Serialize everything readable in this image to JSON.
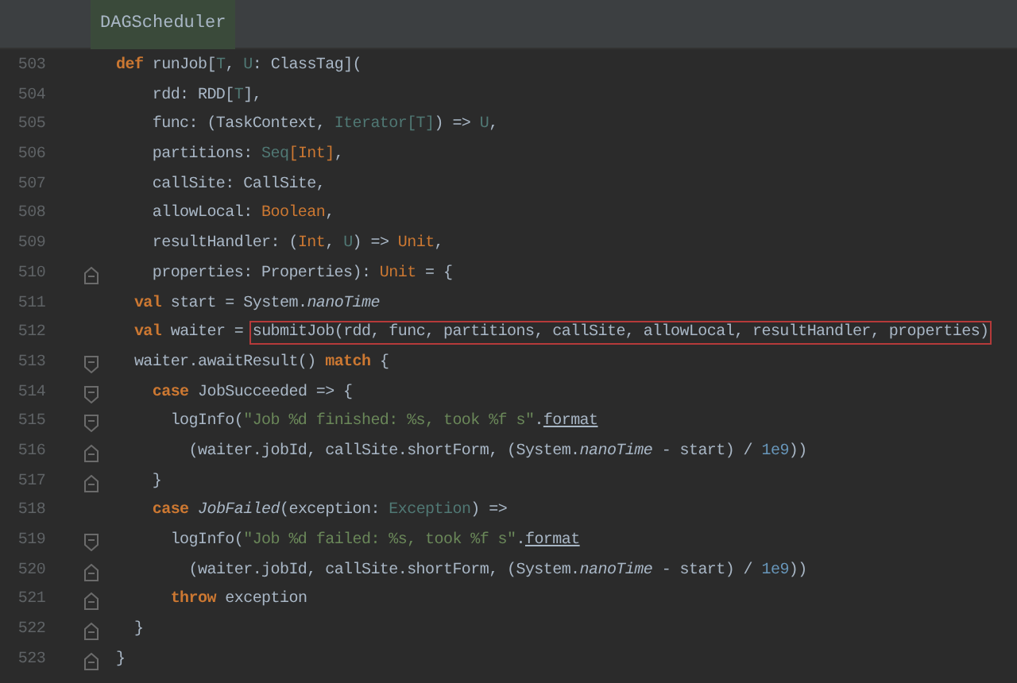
{
  "tab": {
    "label": "DAGScheduler",
    "selected": true
  },
  "lines": [
    {
      "number": "503",
      "fold_start": false,
      "fold_end": false,
      "tokens": [
        {
          "kind": "keyword",
          "text": "def"
        },
        {
          "kind": "plain",
          "text": " runJob["
        },
        {
          "kind": "type",
          "text": "T"
        },
        {
          "kind": "plain",
          "text": ", "
        },
        {
          "kind": "type",
          "text": "U"
        },
        {
          "kind": "plain",
          "text": ": ClassTag]("
        }
      ]
    },
    {
      "number": "504",
      "fold_start": false,
      "fold_end": false,
      "tokens": [
        {
          "kind": "plain",
          "text": "    rdd: RDD["
        },
        {
          "kind": "type",
          "text": "T"
        },
        {
          "kind": "plain",
          "text": "],"
        }
      ]
    },
    {
      "number": "505",
      "fold_start": false,
      "fold_end": false,
      "tokens": [
        {
          "kind": "plain",
          "text": "    func: (TaskContext, "
        },
        {
          "kind": "type",
          "text": "Iterator[T]"
        },
        {
          "kind": "plain",
          "text": ") => "
        },
        {
          "kind": "type",
          "text": "U"
        },
        {
          "kind": "plain",
          "text": ","
        }
      ]
    },
    {
      "number": "506",
      "fold_start": false,
      "fold_end": false,
      "tokens": [
        {
          "kind": "plain",
          "text": "    partitions: "
        },
        {
          "kind": "type",
          "text": "Seq"
        },
        {
          "kind": "builtin",
          "text": "[Int]"
        },
        {
          "kind": "plain",
          "text": ","
        }
      ]
    },
    {
      "number": "507",
      "fold_start": false,
      "fold_end": false,
      "tokens": [
        {
          "kind": "plain",
          "text": "    callSite: CallSite,"
        }
      ]
    },
    {
      "number": "508",
      "fold_start": false,
      "fold_end": false,
      "tokens": [
        {
          "kind": "plain",
          "text": "    allowLocal: "
        },
        {
          "kind": "builtin",
          "text": "Boolean"
        },
        {
          "kind": "plain",
          "text": ","
        }
      ]
    },
    {
      "number": "509",
      "fold_start": false,
      "fold_end": false,
      "tokens": [
        {
          "kind": "plain",
          "text": "    resultHandler: ("
        },
        {
          "kind": "builtin",
          "text": "Int"
        },
        {
          "kind": "plain",
          "text": ", "
        },
        {
          "kind": "type",
          "text": "U"
        },
        {
          "kind": "plain",
          "text": ") => "
        },
        {
          "kind": "builtin",
          "text": "Unit"
        },
        {
          "kind": "plain",
          "text": ","
        }
      ]
    },
    {
      "number": "510",
      "fold_start": false,
      "fold_end": true,
      "tokens": [
        {
          "kind": "plain",
          "text": "    properties: Properties): "
        },
        {
          "kind": "builtin",
          "text": "Unit"
        },
        {
          "kind": "plain",
          "text": " = {"
        }
      ]
    },
    {
      "number": "511",
      "fold_start": false,
      "fold_end": false,
      "tokens": [
        {
          "kind": "keyword",
          "text": "  val"
        },
        {
          "kind": "plain",
          "text": " start = System."
        },
        {
          "kind": "italic",
          "text": "nanoTime"
        }
      ]
    },
    {
      "number": "512",
      "fold_start": false,
      "fold_end": false,
      "tokens": [
        {
          "kind": "keyword",
          "text": "  val"
        },
        {
          "kind": "plain",
          "text": " waiter = "
        },
        {
          "kind": "boxed",
          "text": "submitJob(rdd, func, partitions, callSite, allowLocal, resultHandler, properties)"
        }
      ]
    },
    {
      "number": "513",
      "fold_start": true,
      "fold_end": false,
      "tokens": [
        {
          "kind": "plain",
          "text": "  waiter.awaitResult() "
        },
        {
          "kind": "keyword",
          "text": "match"
        },
        {
          "kind": "plain",
          "text": " {"
        }
      ]
    },
    {
      "number": "514",
      "fold_start": true,
      "fold_end": false,
      "tokens": [
        {
          "kind": "keyword",
          "text": "    case"
        },
        {
          "kind": "plain",
          "text": " JobSucceeded => {"
        }
      ]
    },
    {
      "number": "515",
      "fold_start": true,
      "fold_end": false,
      "tokens": [
        {
          "kind": "plain",
          "text": "      logInfo("
        },
        {
          "kind": "string",
          "text": "\"Job %d finished: %s, took %f s\""
        },
        {
          "kind": "plain",
          "text": "."
        },
        {
          "kind": "link",
          "text": "format"
        }
      ]
    },
    {
      "number": "516",
      "fold_start": false,
      "fold_end": true,
      "tokens": [
        {
          "kind": "plain",
          "text": "        (waiter.jobId, callSite.shortForm, (System."
        },
        {
          "kind": "italic",
          "text": "nanoTime"
        },
        {
          "kind": "plain",
          "text": " - start) / "
        },
        {
          "kind": "number",
          "text": "1e9"
        },
        {
          "kind": "plain",
          "text": "))"
        }
      ]
    },
    {
      "number": "517",
      "fold_start": false,
      "fold_end": true,
      "tokens": [
        {
          "kind": "plain",
          "text": "    }"
        }
      ]
    },
    {
      "number": "518",
      "fold_start": false,
      "fold_end": false,
      "tokens": [
        {
          "kind": "keyword",
          "text": "    case"
        },
        {
          "kind": "italic",
          "text": " JobFailed"
        },
        {
          "kind": "plain",
          "text": "(exception: "
        },
        {
          "kind": "type",
          "text": "Exception"
        },
        {
          "kind": "plain",
          "text": ") =>"
        }
      ]
    },
    {
      "number": "519",
      "fold_start": true,
      "fold_end": false,
      "tokens": [
        {
          "kind": "plain",
          "text": "      logInfo("
        },
        {
          "kind": "string",
          "text": "\"Job %d failed: %s, took %f s\""
        },
        {
          "kind": "plain",
          "text": "."
        },
        {
          "kind": "link",
          "text": "format"
        }
      ]
    },
    {
      "number": "520",
      "fold_start": false,
      "fold_end": true,
      "tokens": [
        {
          "kind": "plain",
          "text": "        (waiter.jobId, callSite.shortForm, (System."
        },
        {
          "kind": "italic",
          "text": "nanoTime"
        },
        {
          "kind": "plain",
          "text": " - start) / "
        },
        {
          "kind": "number",
          "text": "1e9"
        },
        {
          "kind": "plain",
          "text": "))"
        }
      ]
    },
    {
      "number": "521",
      "fold_start": false,
      "fold_end": true,
      "tokens": [
        {
          "kind": "keyword",
          "text": "      throw"
        },
        {
          "kind": "plain",
          "text": " exception"
        }
      ]
    },
    {
      "number": "522",
      "fold_start": false,
      "fold_end": true,
      "tokens": [
        {
          "kind": "plain",
          "text": "  }"
        }
      ]
    },
    {
      "number": "523",
      "fold_start": false,
      "fold_end": true,
      "tokens": [
        {
          "kind": "plain",
          "text": "}"
        }
      ]
    }
  ]
}
